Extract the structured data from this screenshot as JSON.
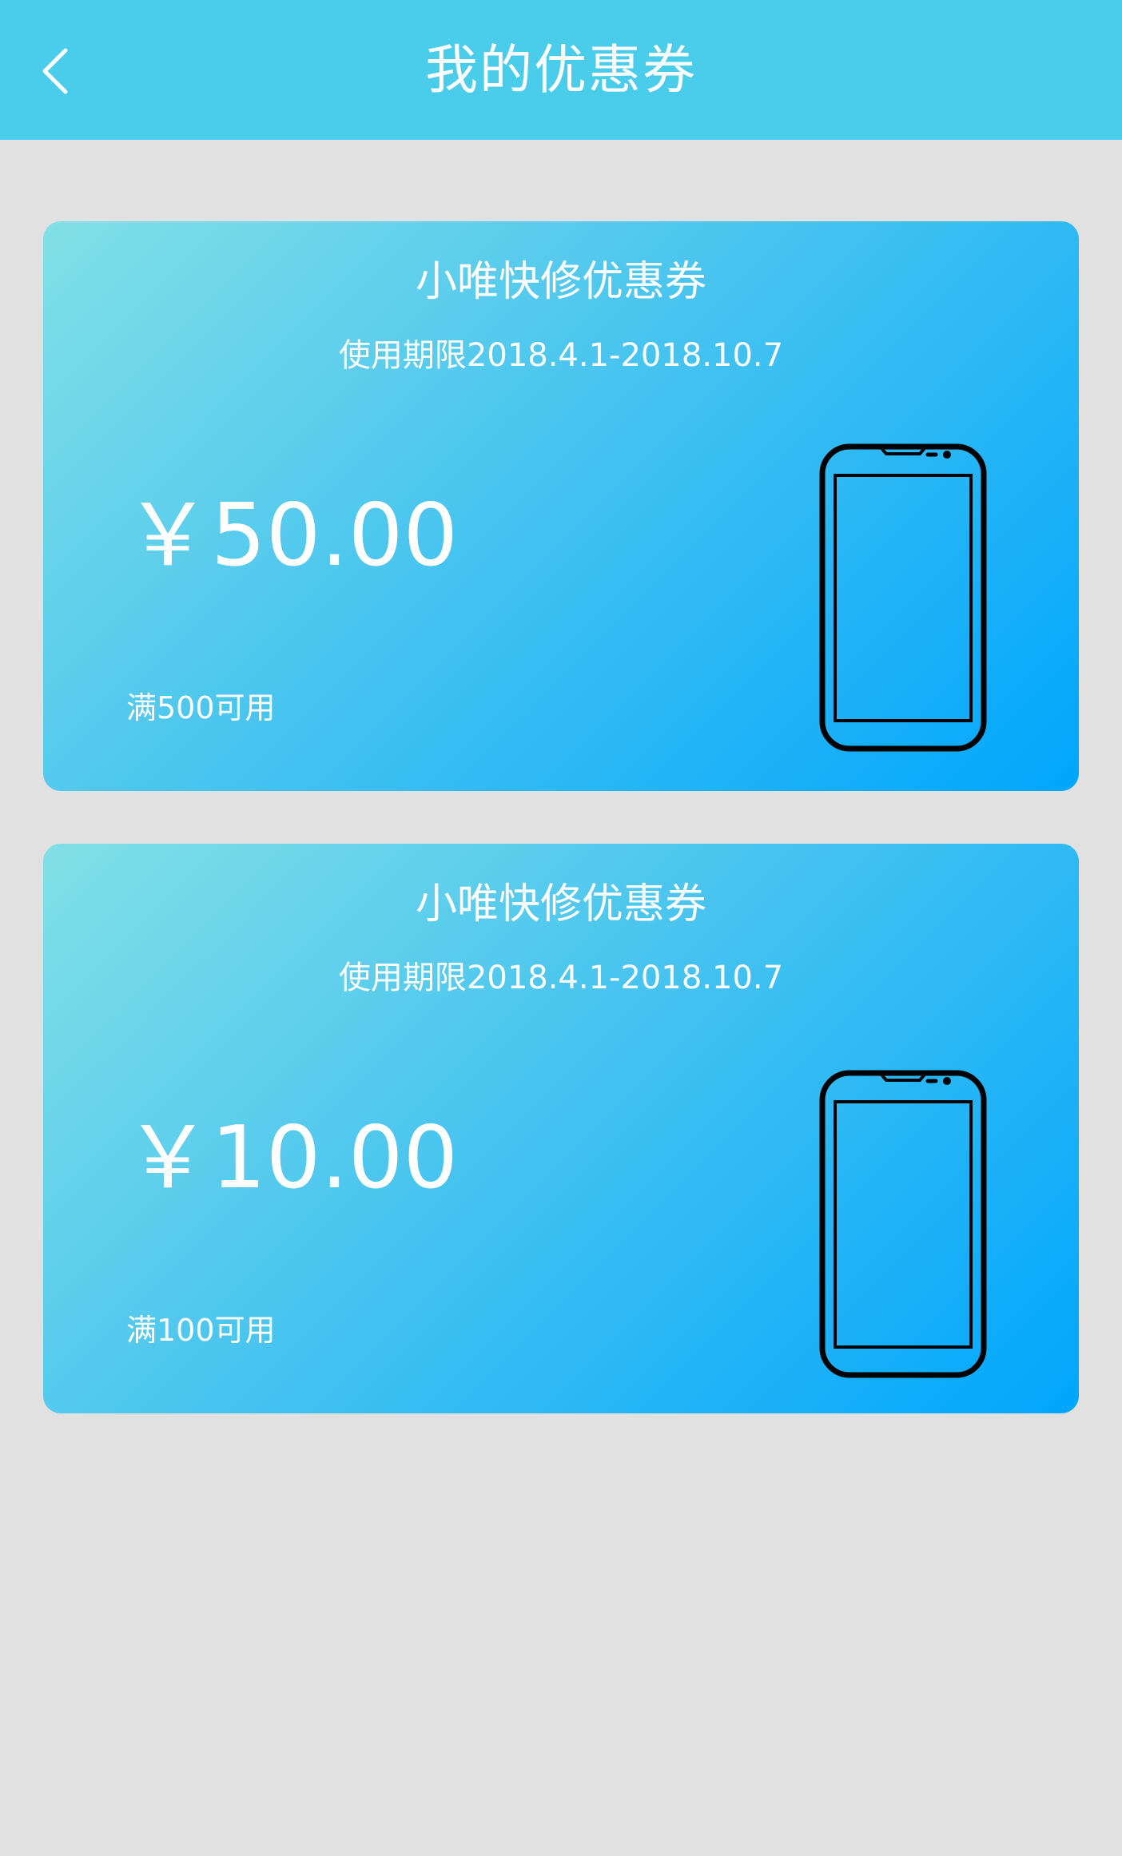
{
  "header": {
    "title": "我的优惠券",
    "back_icon": "chevron-left-icon",
    "background_color": "#4acdea"
  },
  "page": {
    "background_color": "#e1e1e1"
  },
  "coupons": [
    {
      "title": "小唯快修优惠券",
      "period": "使用期限2018.4.1-2018.10.7",
      "amount": "￥50.00",
      "condition": "满500可用",
      "icon": "smartphone-icon"
    },
    {
      "title": "小唯快修优惠券",
      "period": "使用期限2018.4.1-2018.10.7",
      "amount": "￥10.00",
      "condition": "满100可用",
      "icon": "smartphone-icon"
    }
  ],
  "colors": {
    "card_gradient_start": "#82e0e6",
    "card_gradient_end": "#00a6fd",
    "text": "#ffffff",
    "icon_stroke": "#000000"
  }
}
